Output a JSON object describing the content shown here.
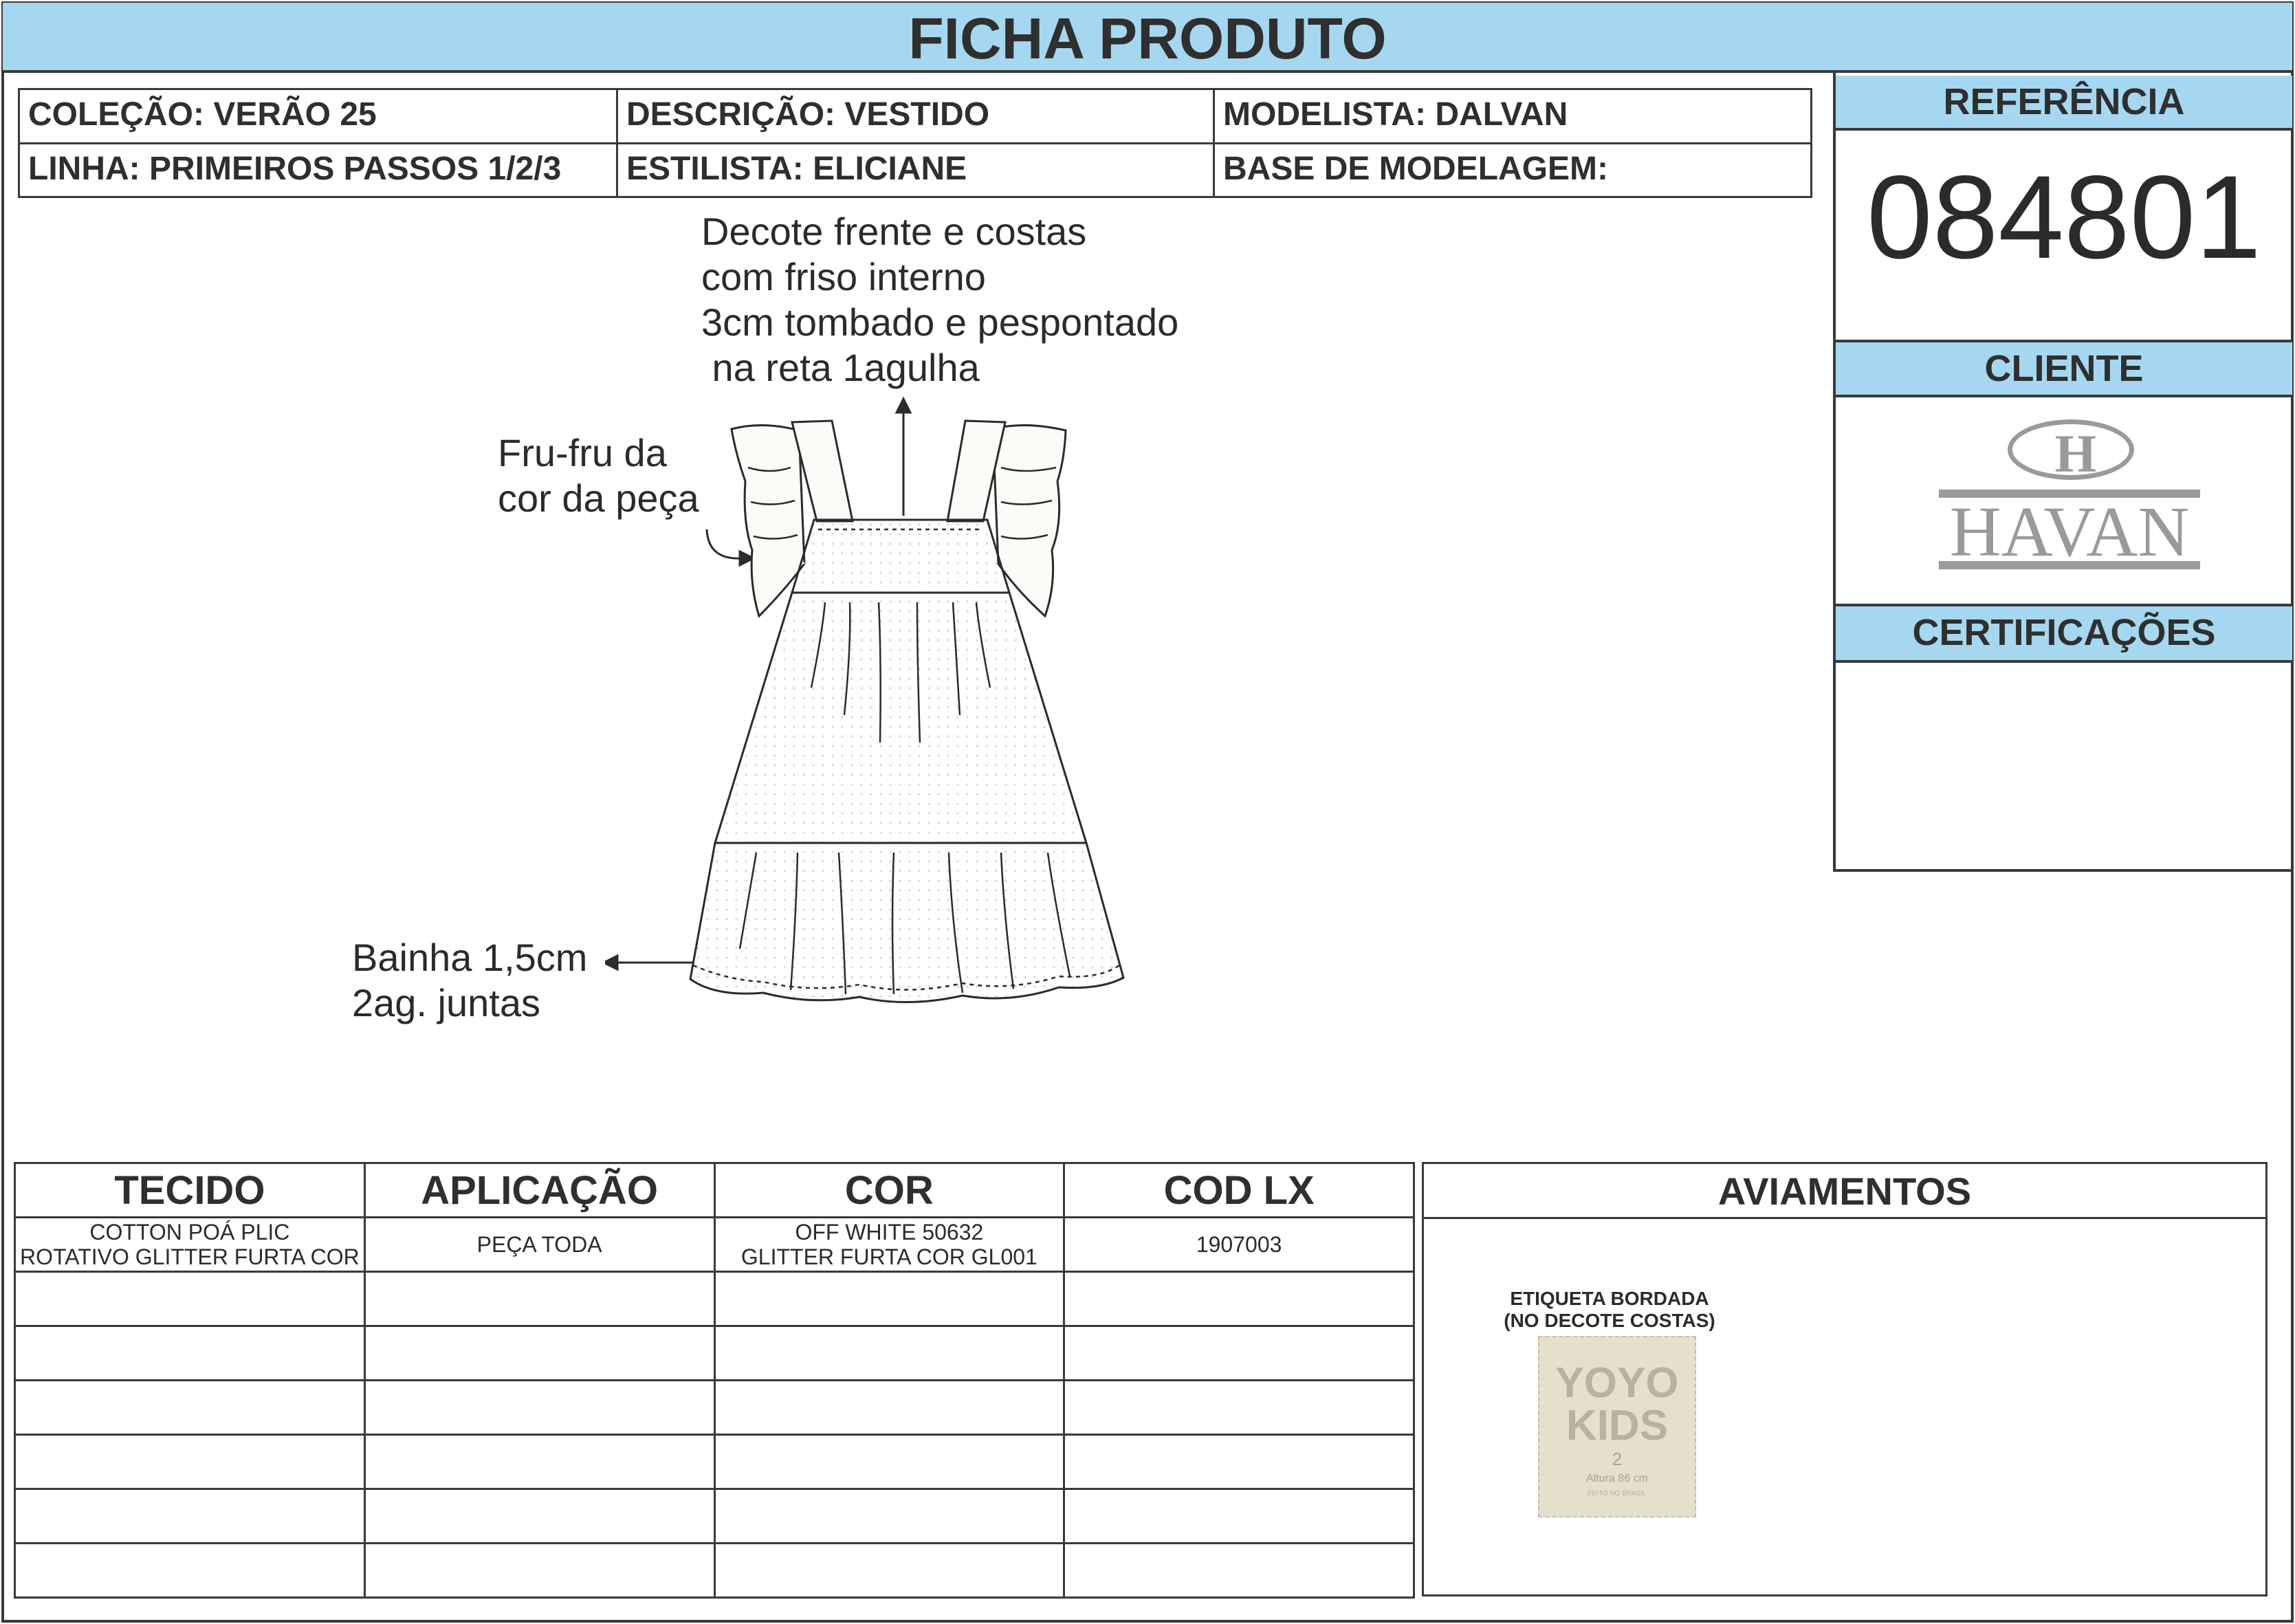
{
  "header": {
    "title": "FICHA PRODUTO"
  },
  "info": {
    "colecao": "COLEÇÃO: VERÃO 25",
    "descricao": "DESCRIÇÃO: VESTIDO",
    "modelista": "MODELISTA: DALVAN",
    "linha": "LINHA: PRIMEIROS PASSOS 1/2/3",
    "estilista": "ESTILISTA: ELICIANE",
    "base": "BASE DE MODELAGEM:"
  },
  "side": {
    "referencia_label": "REFERÊNCIA",
    "referencia_value": "084801",
    "cliente_label": "CLIENTE",
    "cliente_logo_text": "HAVAN",
    "cliente_logo_letter": "H",
    "certificacoes_label": "CERTIFICAÇÕES"
  },
  "annotations": {
    "decote": "Decote frente e costas\ncom friso interno\n3cm tombado e pespontado\n na reta 1agulha",
    "frufru": "Fru-fru da\ncor da peça",
    "bainha": "Bainha 1,5cm\n2ag. juntas"
  },
  "materials": {
    "headers": [
      "TECIDO",
      "APLICAÇÃO",
      "COR",
      "COD LX"
    ],
    "rows": [
      [
        "COTTON POÁ PLIC\nROTATIVO GLITTER FURTA COR",
        "PEÇA TODA",
        "OFF WHITE 50632\nGLITTER FURTA COR GL001",
        "1907003"
      ]
    ]
  },
  "aviamentos": {
    "title": "AVIAMENTOS",
    "label_line1": "ETIQUETA BORDADA",
    "label_line2": "(NO DECOTE COSTAS)",
    "tag_line1": "YOYO",
    "tag_line2": "KIDS",
    "tag_size": "2",
    "tag_height": "Altura 86 cm",
    "tag_made": "FEITO NO BRASIL"
  },
  "colors": {
    "header_blue": "#a5d8f0",
    "border": "#3a3a3a",
    "logo_gray": "#9a9a9a",
    "tag_bg": "#e4e0cc"
  }
}
